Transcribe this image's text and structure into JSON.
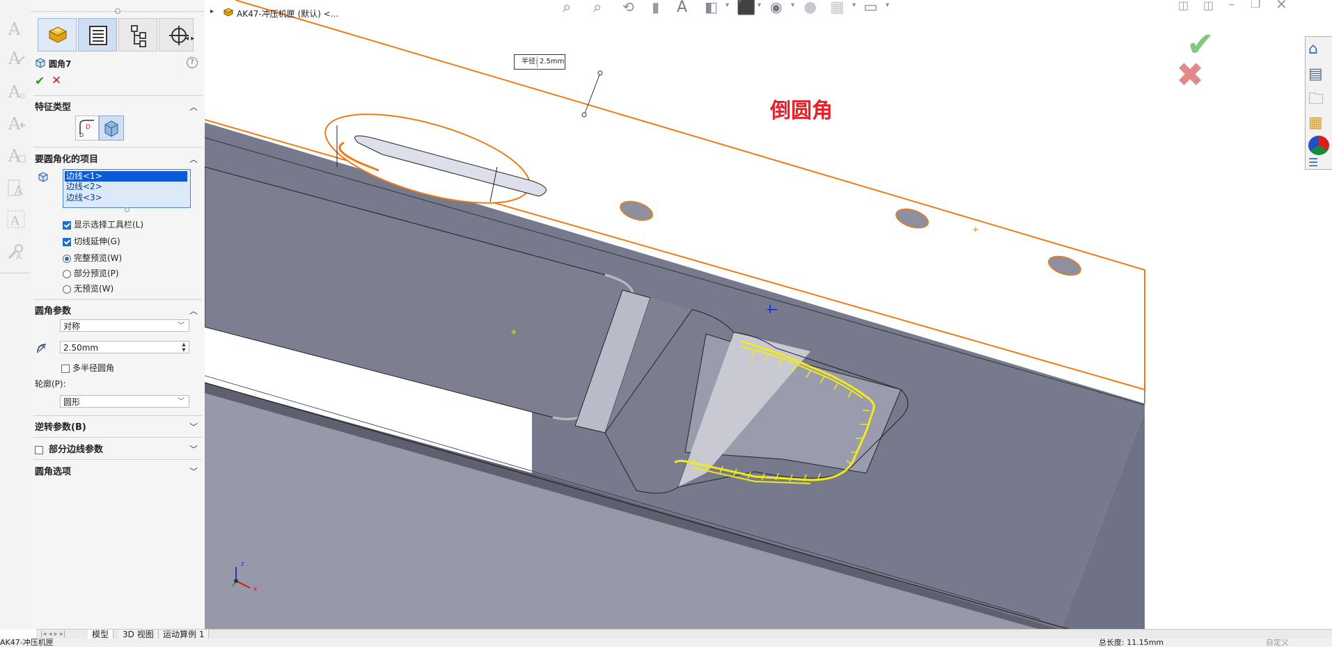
{
  "tree": {
    "breadcrumb": "AK47-冲压机匣 (默认) <..."
  },
  "property_manager": {
    "feature_name": "圆角7",
    "feature_type": {
      "title": "特征类型"
    },
    "items_to_fillet": {
      "title": "要圆角化的项目",
      "selections": [
        "边线<1>",
        "边线<2>",
        "边线<3>"
      ],
      "show_toolbar": "显示选择工具栏(L)",
      "tangent_propagation": "切线延伸(G)",
      "preview": {
        "full": "完整预览(W)",
        "partial": "部分预览(P)",
        "none": "无预览(W)",
        "selected": "full"
      }
    },
    "fillet_params": {
      "title": "圆角参数",
      "method": "对称",
      "radius": "2.50mm",
      "multi_radius": "多半径圆角",
      "profile_label": "轮廓(P):",
      "profile": "圆形"
    },
    "setback": {
      "title": "逆转参数(B)"
    },
    "partial_edge": {
      "title": "部分边线参数"
    },
    "fillet_options": {
      "title": "圆角选项"
    }
  },
  "viewport": {
    "callout_label": "半径:",
    "callout_value": "2.5mm",
    "annotation": "倒圆角",
    "annotation_color": "#e8202a",
    "triad": {
      "z": "z",
      "x": "x"
    }
  },
  "bottom_tabs": [
    "模型",
    "3D 视图",
    "运动算例 1"
  ],
  "statusbar": {
    "left": "AK47-冲压机匣",
    "total_length": "总长度: 11.15mm",
    "custom": "自定义"
  },
  "colors": {
    "face": "#777a8c",
    "edge_orange": "#f07a12",
    "highlight_yellow": "#f2ea1a",
    "accept_green": "#7fc97f",
    "cancel_red": "#e28a8a"
  }
}
